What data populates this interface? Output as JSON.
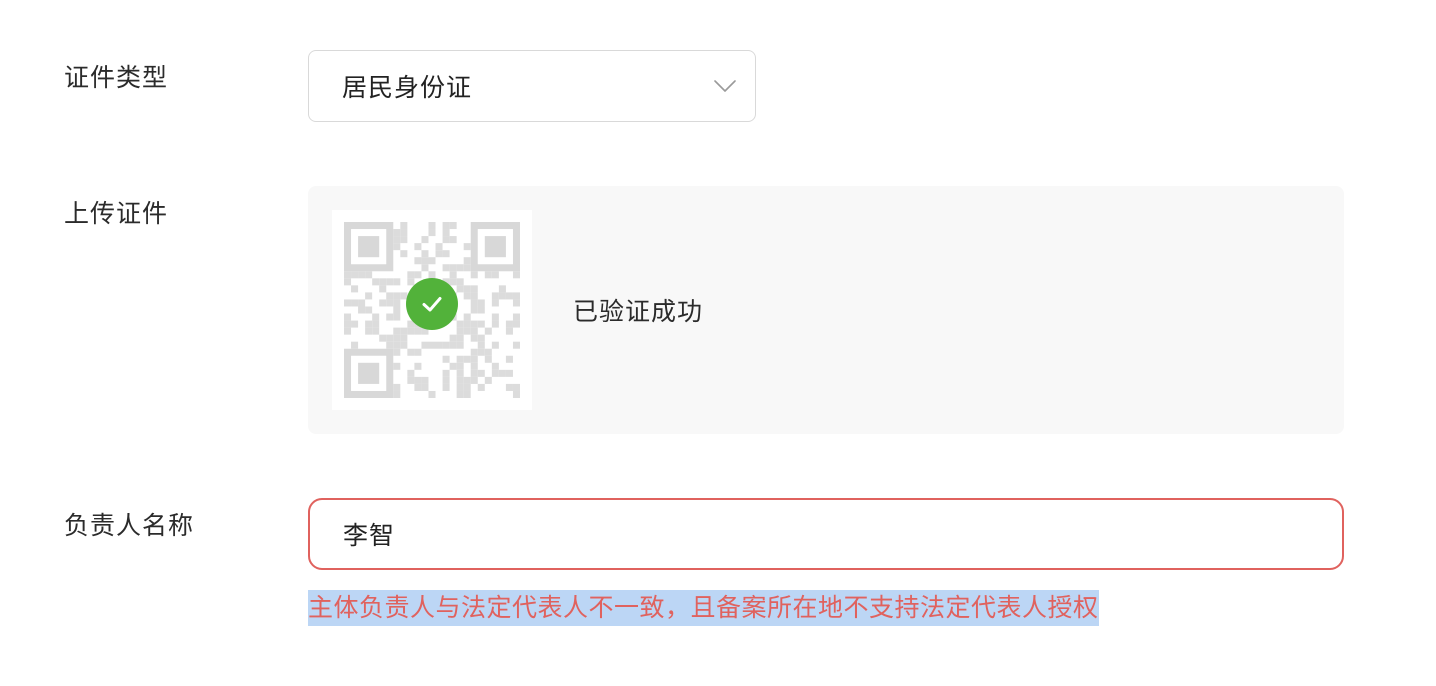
{
  "form": {
    "id_type": {
      "label": "证件类型",
      "selected": "居民身份证",
      "icon": "chevron-down-icon"
    },
    "upload": {
      "label": "上传证件",
      "status_text": "已验证成功",
      "status_icon": "check-circle-icon",
      "status_color": "#52b23a"
    },
    "principal_name": {
      "label": "负责人名称",
      "value": "李智",
      "error_color": "#e0625e"
    },
    "error_message": "主体负责人与法定代表人不一致，且备案所在地不支持法定代表人授权"
  }
}
